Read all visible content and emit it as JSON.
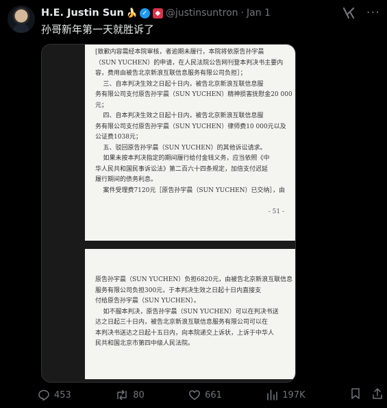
{
  "header": {
    "name": "H.E. Justin Sun",
    "handle": "@justinsuntron",
    "separator": "·",
    "date": "Jan 1"
  },
  "tweet": {
    "text": "孙哥新年第一天就胜诉了"
  },
  "document": {
    "page1_lines": [
      "[致歉内容需经本院审核，者逾期未履行，本院将依原告孙宇晨",
      "（SUN YUCHEN）的申请，在人民法院公告网刊登本判决书主要内",
      "容，费用由被告北京新浪互联信息服务有限公司负担］；",
      "    三、自本判决生效之日起十日内，被告北京新浪互联信息服",
      "务有限公司支付原告孙宇晨（SUN YUCHEN）精神损害抚慰金20 000",
      "元；",
      "    四、自本判决生效之日起十日内，被告北京新浪互联信息服",
      "务有限公司支付原告孙宇晨（SUN YUCHEN）律师费10 000元以及",
      "公证费1038元；",
      "    五、驳回原告孙宇晨（SUN YUCHEN）的其他诉讼请求。",
      "    如果未按本判决指定的期间履行给付金钱义务，应当依照《中",
      "华人民共和国民事诉讼法》第二百六十四条规定，加倍支付迟延",
      "履行期间的债务利息。",
      "    案件受理费7120元［原告孙宇晨（SUN YUCHEN）已交纳］，由"
    ],
    "page1_number": "- 51 -",
    "page2_lines": [
      "原告孙宇晨（SUN YUCHEN）负担6820元，由被告北京新浪互联信息",
      "服务有限公司负担300元，于本判决生效之日起十日内直接支",
      "付给原告孙宇晨（SUN YUCHEN）。",
      "    如不服本判决，原告孙宇晨（SUN YUCHEN）可以在判决书送",
      "达之日起三十日内，被告北京新浪互联信息服务有限公司可以在",
      "本判决书送达之日起十五日内，向本院递交上诉状，上诉于中华人",
      "民共和国北京市第四中级人民法院。"
    ]
  },
  "stats": {
    "replies": "453",
    "reposts": "80",
    "likes": "661",
    "views": "197K"
  },
  "colors": {
    "background": "#000000",
    "text": "#e7e9ea",
    "muted": "#71767b",
    "verified": "#1d9bf0",
    "document": "#f4f4f1"
  },
  "icons": [
    "verified-badge-icon",
    "banana-emoji-icon",
    "red-badge-icon",
    "grok-icon",
    "more-icon",
    "reply-icon",
    "repost-icon",
    "like-icon",
    "views-icon",
    "bookmark-icon",
    "share-icon"
  ]
}
